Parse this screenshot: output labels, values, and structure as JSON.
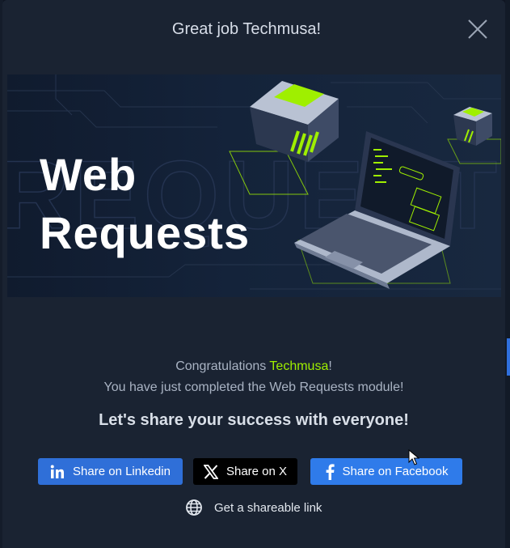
{
  "modal": {
    "title": "Great job Techmusa!",
    "close_icon": "close-icon"
  },
  "banner": {
    "title_line1": "Web",
    "title_line2": "Requests",
    "background_word": "REQUESTS",
    "accent_color": "#9fef00"
  },
  "message": {
    "congrats_prefix": "Congratulations ",
    "username": "Techmusa",
    "congrats_suffix": "!",
    "completed_text": "You have just completed the Web Requests module!",
    "share_heading": "Let's share your success with everyone!"
  },
  "share": {
    "linkedin_label": "Share on Linkedin",
    "linkedin_icon": "linkedin-icon",
    "x_label": "Share on X",
    "x_icon": "x-logo-icon",
    "facebook_label": "Share on Facebook",
    "facebook_icon": "facebook-icon",
    "link_label": "Get a shareable link",
    "link_icon": "globe-icon"
  }
}
